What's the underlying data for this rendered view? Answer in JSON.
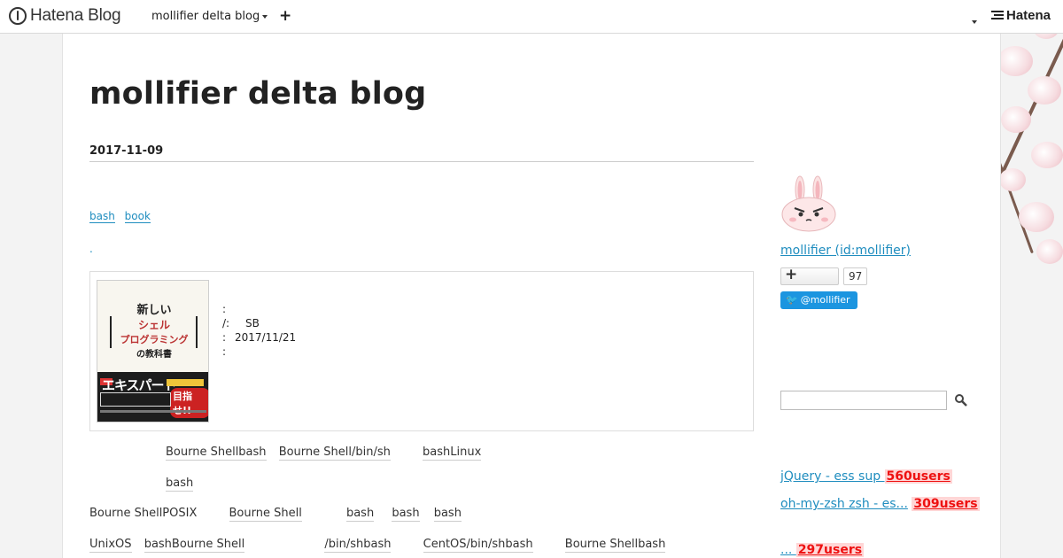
{
  "globalheader": {
    "logo_text": "Hatena Blog",
    "blog_name": "mollifier delta blog",
    "plus_label": "+",
    "hatena_label": "Hatena"
  },
  "blog": {
    "title": "mollifier delta blog",
    "date": "2017-11-09",
    "categories": [
      "bash",
      "book"
    ],
    "dot_link": "."
  },
  "book": {
    "cover": {
      "title_l1": "新しい",
      "title_l2": "シェル",
      "title_l3": "プログラミング",
      "title_l4": "の教科書",
      "expert": "エキスパート",
      "mezase": "目指せ!!"
    },
    "meta": [
      {
        "k": ":",
        "v": ""
      },
      {
        "k": "/:",
        "v": "SB"
      },
      {
        "k": ":",
        "v": "2017/11/21"
      },
      {
        "k": ":",
        "v": ""
      }
    ]
  },
  "body": {
    "line1": [
      "Bourne Shellbash",
      "Bourne Shell/bin/sh",
      "bashLinux"
    ],
    "line2": [
      "bash"
    ],
    "line3_text": "Bourne ShellPOSIX",
    "line3": [
      "Bourne Shell",
      "bash",
      "bash",
      "bash"
    ],
    "line4": [
      "UnixOS",
      "bashBourne Shell",
      "/bin/shbash",
      "CentOS/bin/shbash",
      "Bourne Shellbash"
    ]
  },
  "sidebar": {
    "profile_name": "mollifier (id:mollifier)",
    "subscriber_count": "97",
    "twitter_label": "@mollifier",
    "search_placeholder": "",
    "hot_entries": [
      {
        "title": "jQuery  - ess sup ",
        "users": "560users"
      },
      {
        "title": "oh-my-zsh  zsh  -                                      es...",
        "users": "309users"
      },
      {
        "title": "  ...       ",
        "users": "297users"
      }
    ]
  }
}
